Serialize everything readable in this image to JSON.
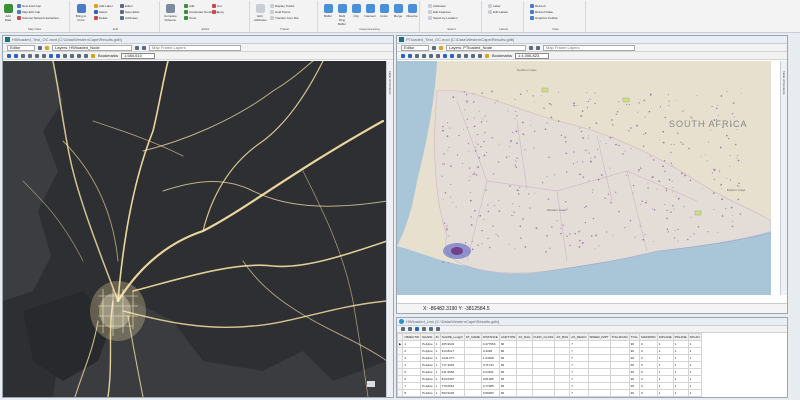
{
  "ribbon": {
    "groups": [
      "Map Data",
      "Edit",
      "Editor",
      "Transit",
      "Geoprocessing",
      "Select",
      "Labels",
      "View"
    ],
    "add_data": "Add Data",
    "items": {
      "g1": [
        "New Fold Cap",
        "Map Edit Cap",
        "Subsnet Network Extraction..."
      ],
      "g2": [
        "Bring to Front",
        "Add Label",
        "Select",
        "Delete",
        "Find"
      ],
      "g3": [
        "Editor",
        "Save Edits",
        "Cut",
        "Copy",
        "Attributes"
      ],
      "g4": [
        "Complete Schema",
        "Add",
        "Accelerate Numbering",
        "Tools"
      ],
      "g5": [
        "Edit Attributes",
        "Display Tracks",
        "Hold Points",
        "Transfer from File",
        "Publish Data"
      ],
      "g6": [
        "Buffer",
        "Multi Ring Buffer",
        "Clip",
        "Intersect",
        "Union",
        "Merge",
        "Dissolve"
      ],
      "g7": [
        "Attributes",
        "Edit Features",
        "Select by Location"
      ],
      "g8": [
        "Label",
        "Edit Labels"
      ],
      "g9": [
        "Refresh",
        "Refresh Data",
        "Graphics Toolbar"
      ]
    }
  },
  "left_pane": {
    "title": "HWloaded_Test_OC.mxd [C:\\Data\\WesternCape\\Results.gdb]",
    "editor_label": "Editor",
    "layers_label": "Layers: HWloaded_Node",
    "frame_label": "Map Frame Layers",
    "bookmarks_label": "Bookmarks",
    "scale": "1:584,610",
    "side_tab": "Table of Contents"
  },
  "right_pane": {
    "title": "PTloaded_Test_OC.mxd [C:\\Data\\WesternCape\\Results.gdb]",
    "editor_label": "Editor",
    "layers_label": "Layers: PTloaded_Node",
    "frame_label": "Map Frame Layers",
    "bookmarks_label": "Bookmarks",
    "scale": "1:4,006,823",
    "coords": "X: -86482.3190 Y: -3812584.5",
    "map_label": "SOUTH AFRICA",
    "place_labels": [
      "Northern Cape",
      "Western Cape",
      "Eastern Cape"
    ],
    "side_tab": "Table of Contents"
  },
  "table_pane": {
    "title": "HWloaded_Link [C:\\Data\\WesternCape\\Results.gdb]",
    "columns": [
      "OBJECTID",
      "SHAPE",
      "ID",
      "SHAPE_Length",
      "ST_NAME",
      "DISTANCE",
      "LINKTYPE",
      "AX_DAG",
      "FUNC_CLASS",
      "AX_BUS",
      "AX_REGIO",
      "SPEED_IMPT",
      "TOLLROAD",
      "TOLL",
      "MAINPRIC",
      "DIPLANE",
      "PRLANE",
      "SPLAN"
    ],
    "rows": [
      [
        "1",
        "Polyline",
        "1",
        "465.9634",
        "",
        "0.477066",
        "66",
        "",
        "",
        "",
        "7",
        "",
        "",
        "90",
        "0",
        "1",
        "1",
        "1"
      ],
      [
        "2",
        "Polyline",
        "1",
        "313.8217",
        "",
        "0.3348",
        "66",
        "",
        "",
        "",
        "7",
        "",
        "",
        "90",
        "0",
        "1",
        "1",
        "1"
      ],
      [
        "3",
        "Polyline",
        "2",
        "1244.677",
        "",
        "1.24468",
        "66",
        "",
        "",
        "",
        "7",
        "",
        "",
        "90",
        "0",
        "1",
        "1",
        "1"
      ],
      [
        "4",
        "Polyline",
        "1",
        "717.3315",
        "",
        "0.71734",
        "66",
        "",
        "",
        "",
        "7",
        "",
        "",
        "90",
        "0",
        "1",
        "1",
        "1"
      ],
      [
        "5",
        "Polyline",
        "1",
        "241.5952",
        "",
        "0.24161",
        "66",
        "",
        "",
        "",
        "7",
        "",
        "",
        "90",
        "0",
        "1",
        "1",
        "1"
      ],
      [
        "6",
        "Polyline",
        "1",
        "813.6497",
        "",
        "0.81365",
        "66",
        "",
        "",
        "",
        "7",
        "",
        "",
        "90",
        "0",
        "1",
        "1",
        "1"
      ],
      [
        "7",
        "Polyline",
        "1",
        "779.0516",
        "",
        "0.77905",
        "66",
        "",
        "",
        "",
        "7",
        "",
        "",
        "90",
        "0",
        "1",
        "1",
        "1"
      ],
      [
        "8",
        "Polyline",
        "1",
        "593.5294",
        "",
        "0.59353",
        "66",
        "",
        "",
        "",
        "7",
        "",
        "",
        "90",
        "0",
        "1",
        "1",
        "1"
      ],
      [
        "9",
        "Polyline",
        "1",
        "412.8113",
        "",
        "0.41281",
        "66",
        "",
        "",
        "",
        "7",
        "",
        "",
        "90",
        "0",
        "1",
        "1",
        "1"
      ]
    ]
  },
  "colors": {
    "road_glow": "#ffe9a8",
    "dark_bg": "#2e2f32",
    "network_purple": "#6a2d7a",
    "region_outline": "#8a3a9a"
  }
}
